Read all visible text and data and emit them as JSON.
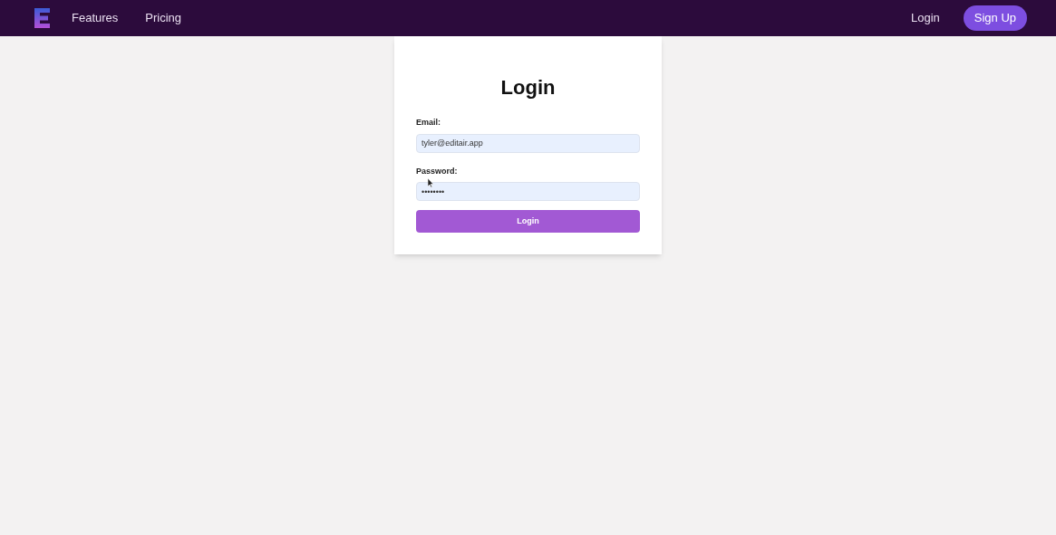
{
  "nav": {
    "links": [
      "Features",
      "Pricing"
    ],
    "login": "Login",
    "signup": "Sign Up"
  },
  "form": {
    "title": "Login",
    "fields": [
      {
        "label": "Email:",
        "value": "tyler@editair.app"
      },
      {
        "label": "Password:",
        "value": "••••••••"
      }
    ],
    "submit": "Login"
  }
}
